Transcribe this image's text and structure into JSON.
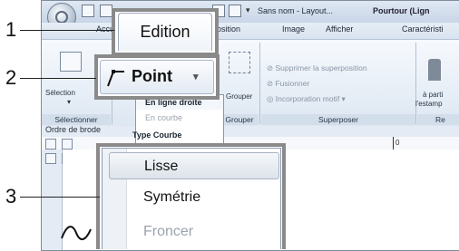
{
  "window": {
    "title": "Sans nom - Layout...",
    "title_right": "Pourtour (Lign",
    "tabs": [
      "Accu",
      "position",
      "Image",
      "Afficher",
      "Caractéristi"
    ]
  },
  "ribbon": {
    "selection_label": "Sélection",
    "selection_group": "Sélectionner",
    "grouper_label": "Grouper",
    "grouper_group": "Grouper",
    "superposer_items": [
      "Supprimer la superposition",
      "Fusionner",
      "Incorporation motif"
    ],
    "superposer_group": "Superposer",
    "right_label_1": "à parti",
    "right_label_2": "l'estamp",
    "right_group": "Re"
  },
  "highlight": {
    "edition_tab": "Edition",
    "point_button": "Point"
  },
  "point_menu": {
    "items": [
      {
        "label": "En ligne droite",
        "enabled": true
      },
      {
        "label": "En courbe",
        "enabled": false
      },
      {
        "label": "Type Courbe",
        "enabled": true
      }
    ]
  },
  "workspace": {
    "sidebar_title": "Ordre de brode",
    "ruler_mark": "0"
  },
  "curve_menu": {
    "items": [
      {
        "label": "Lisse",
        "enabled": true,
        "selected": true
      },
      {
        "label": "Symétrie",
        "enabled": true,
        "selected": false
      },
      {
        "label": "Froncer",
        "enabled": false,
        "selected": false
      }
    ]
  },
  "callouts": [
    "1",
    "2",
    "3"
  ],
  "colors": {
    "highlight_frame": "#8a8a8a",
    "ribbon_bg": "#dde7f2",
    "disabled_text": "#9aa3ae"
  }
}
